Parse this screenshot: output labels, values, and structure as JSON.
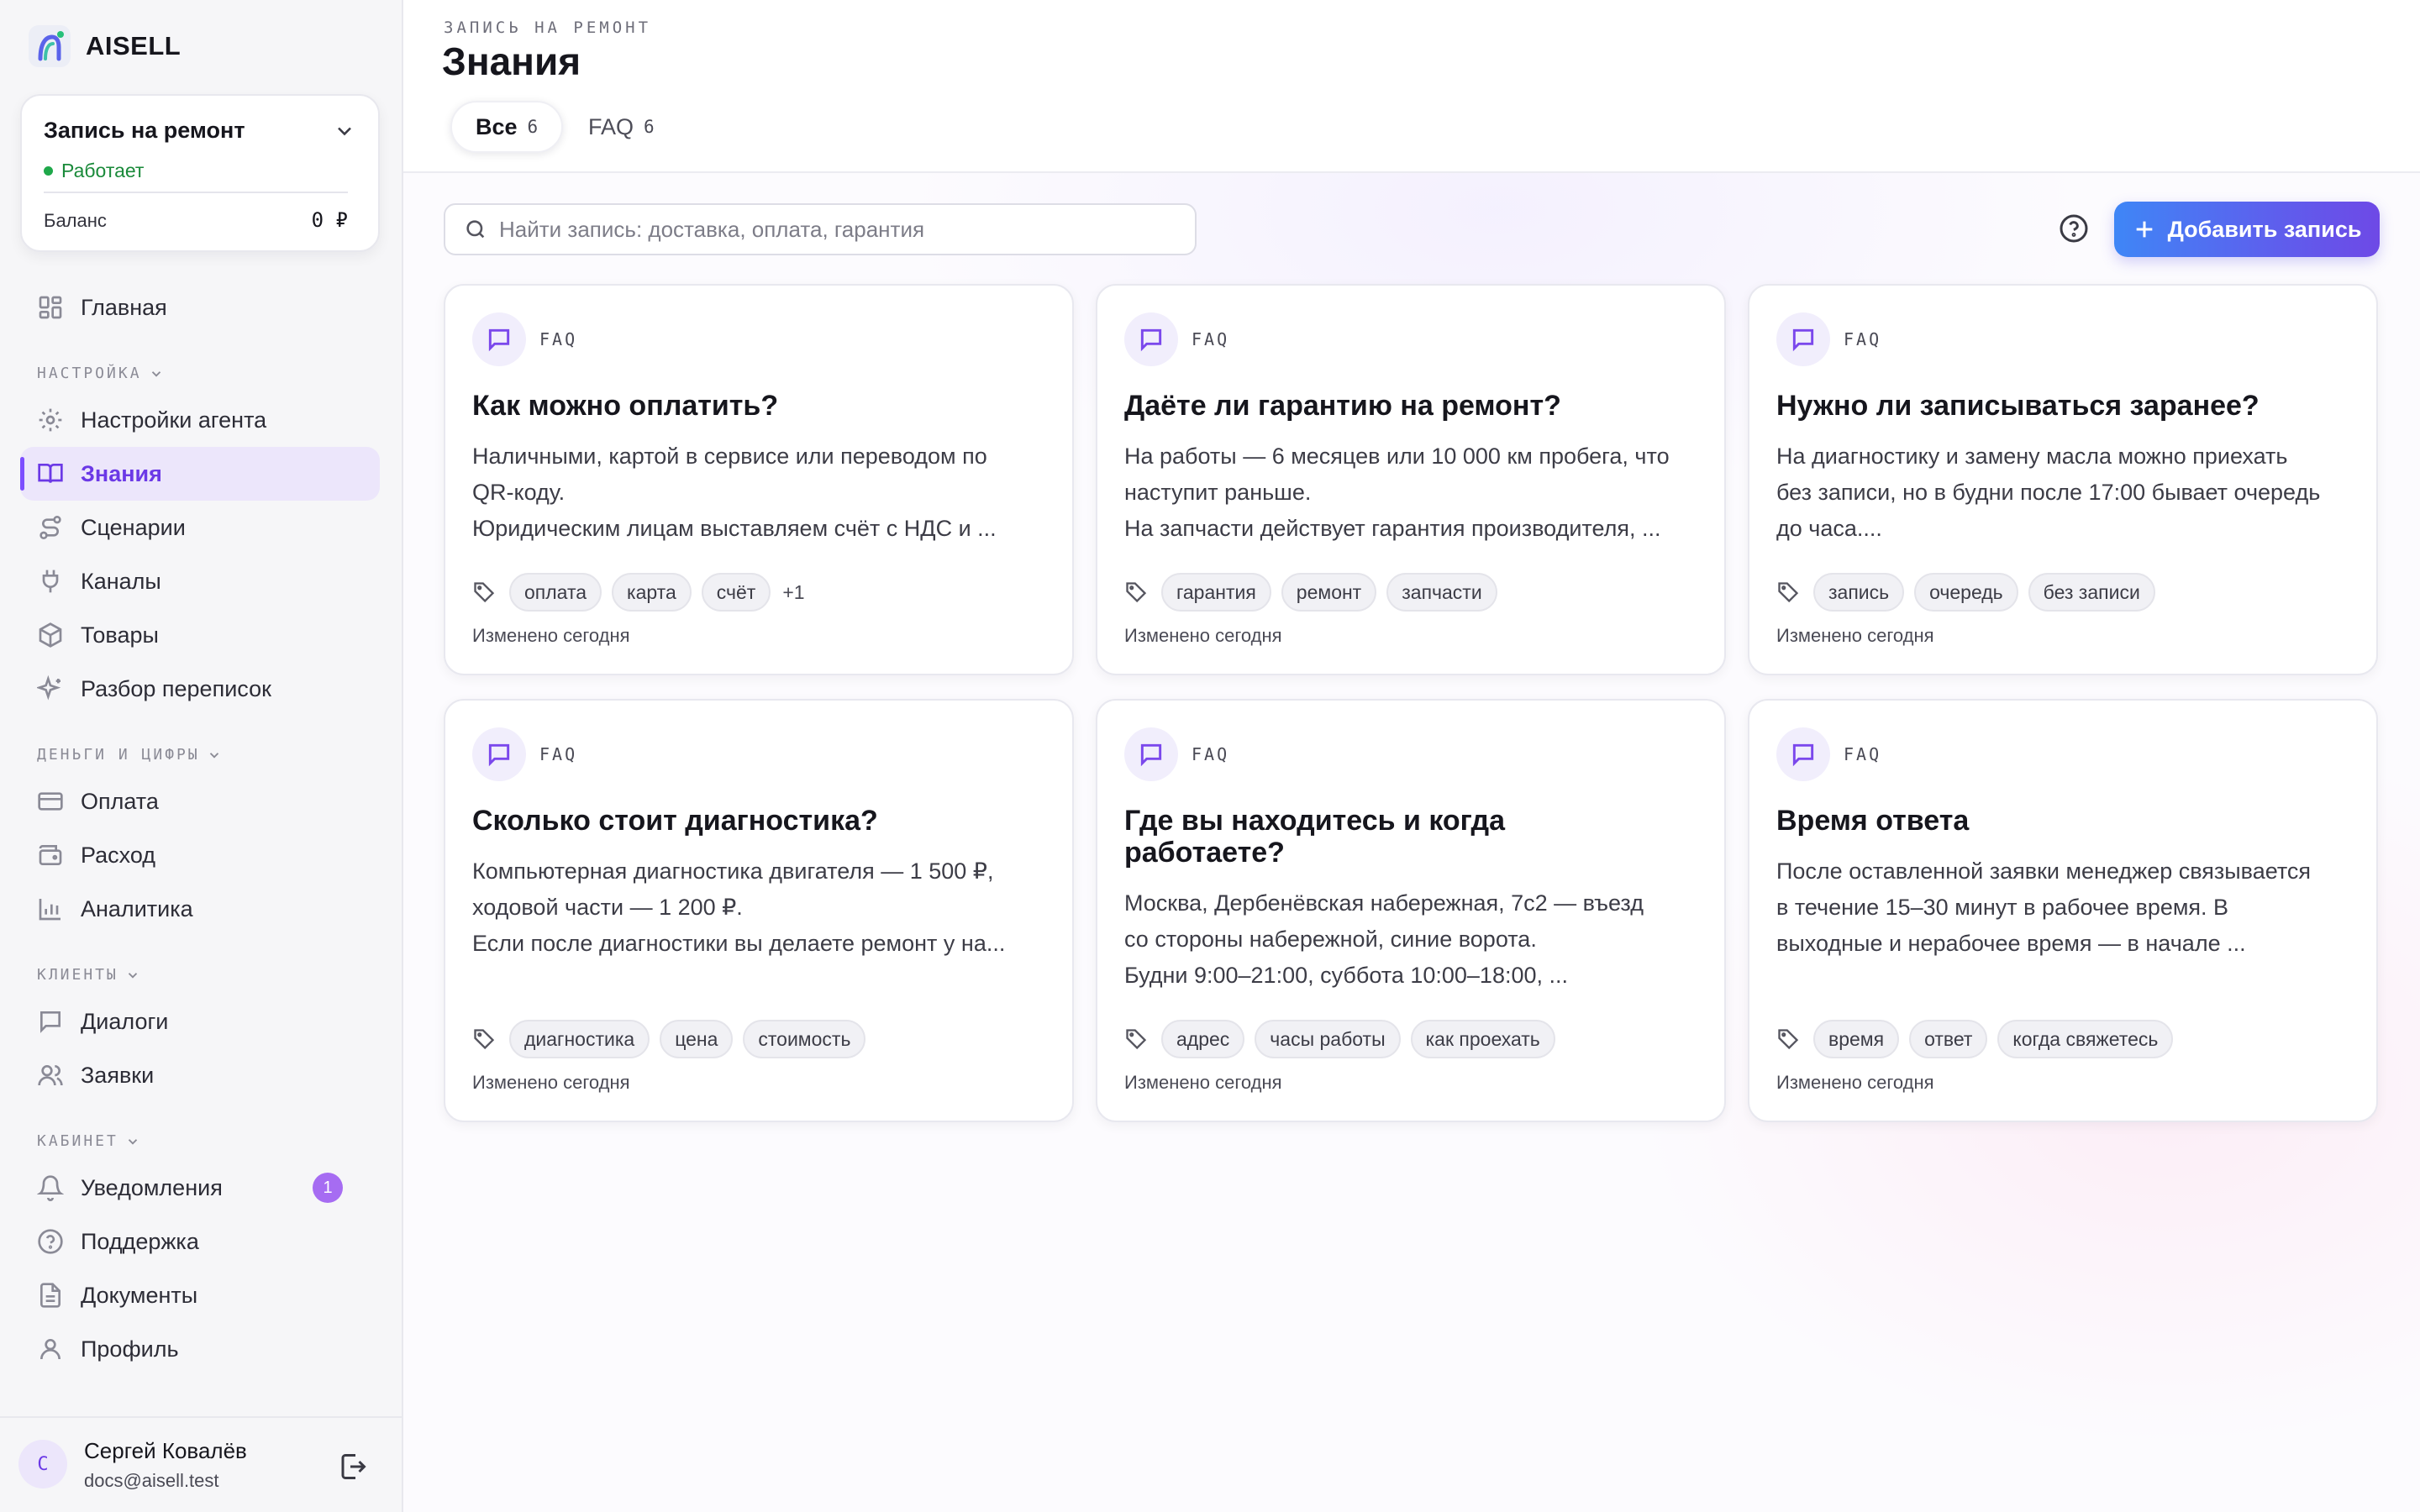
{
  "brand": {
    "name": "AISELL"
  },
  "agent": {
    "name": "Запись на ремонт",
    "status": "Работает",
    "balance_label": "Баланс",
    "balance_value": "0 ₽"
  },
  "nav": {
    "home": "Главная",
    "section_settings": "НАСТРОЙКА",
    "agent_settings": "Настройки агента",
    "knowledge": "Знания",
    "scenarios": "Сценарии",
    "channels": "Каналы",
    "products": "Товары",
    "chat_review": "Разбор переписок",
    "section_money": "ДЕНЬГИ И ЦИФРЫ",
    "payment": "Оплата",
    "expense": "Расход",
    "analytics": "Аналитика",
    "section_clients": "КЛИЕНТЫ",
    "dialogs": "Диалоги",
    "requests": "Заявки",
    "section_cabinet": "КАБИНЕТ",
    "notifications": "Уведомления",
    "notifications_badge": "1",
    "support": "Поддержка",
    "documents": "Документы",
    "profile": "Профиль"
  },
  "user": {
    "initial": "С",
    "name": "Сергей Ковалёв",
    "email": "docs@aisell.test"
  },
  "header": {
    "eyebrow": "ЗАПИСЬ НА РЕМОНТ",
    "title": "Знания"
  },
  "tabs": [
    {
      "label": "Все",
      "count": "6"
    },
    {
      "label": "FAQ",
      "count": "6"
    }
  ],
  "search": {
    "placeholder": "Найти запись: доставка, оплата, гарантия"
  },
  "add_button": "Добавить запись",
  "cards": [
    {
      "type": "FAQ",
      "title": "Как можно оплатить?",
      "body": [
        "Наличными, картой в сервисе или переводом по",
        "QR-коду.",
        "Юридическим лицам выставляем счёт с НДС и ..."
      ],
      "tags": [
        "оплата",
        "карта",
        "счёт"
      ],
      "more": "+1",
      "modified": "Изменено сегодня"
    },
    {
      "type": "FAQ",
      "title": "Даёте ли гарантию на ремонт?",
      "body": [
        "На работы — 6 месяцев или 10 000 км пробега, что",
        "наступит раньше.",
        "На запчасти действует гарантия производителя, ..."
      ],
      "tags": [
        "гарантия",
        "ремонт",
        "запчасти"
      ],
      "more": "",
      "modified": "Изменено сегодня"
    },
    {
      "type": "FAQ",
      "title": "Нужно ли записываться заранее?",
      "body": [
        "На диагностику и замену масла можно приехать",
        "без записи, но в будни после 17:00 бывает очередь",
        "до часа...."
      ],
      "tags": [
        "запись",
        "очередь",
        "без записи"
      ],
      "more": "",
      "modified": "Изменено сегодня"
    },
    {
      "type": "FAQ",
      "title": "Сколько стоит диагностика?",
      "body": [
        "Компьютерная диагностика двигателя — 1 500 ₽,",
        "ходовой части — 1 200 ₽.",
        "Если после диагностики вы делаете ремонт у на..."
      ],
      "tags": [
        "диагностика",
        "цена",
        "стоимость"
      ],
      "more": "",
      "modified": "Изменено сегодня"
    },
    {
      "type": "FAQ",
      "title": "Где вы находитесь и когда работаете?",
      "body": [
        "Москва, Дербенёвская набережная, 7с2 — въезд",
        "со стороны набережной, синие ворота.",
        "Будни 9:00–21:00, суббота 10:00–18:00, ..."
      ],
      "tags": [
        "адрес",
        "часы работы",
        "как проехать"
      ],
      "more": "",
      "modified": "Изменено сегодня"
    },
    {
      "type": "FAQ",
      "title": "Время ответа",
      "body": [
        "После оставленной заявки менеджер связывается",
        "в течение 15–30 минут в рабочее время. В",
        "выходные и нерабочее время — в начале ..."
      ],
      "tags": [
        "время",
        "ответ",
        "когда свяжетесь"
      ],
      "more": "",
      "modified": "Изменено сегодня"
    }
  ]
}
